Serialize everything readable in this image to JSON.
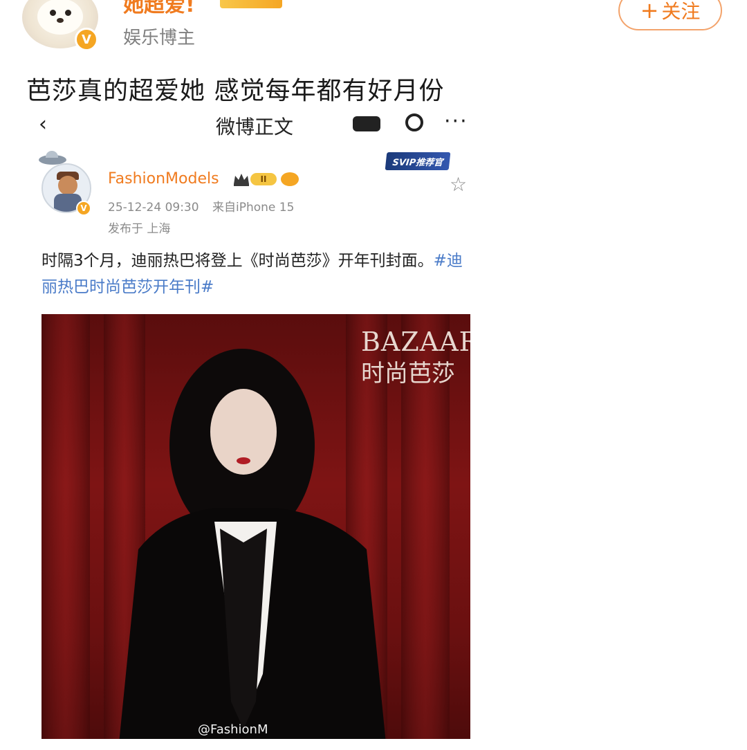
{
  "outer_post": {
    "username": "她超爱!",
    "role": "娱乐博主",
    "follow_label": "关注",
    "follow_plus": "+",
    "verified_mark": "V",
    "text": "芭莎真的超爱她 感觉每年都有好月份"
  },
  "screenshot": {
    "topbar": {
      "back_glyph": "‹",
      "title": "微博正文",
      "more_glyph": "···"
    },
    "post": {
      "username": "FashionModels",
      "level_label": "II",
      "verified_mark": "V",
      "svip_label": "SVIP推荐官",
      "star_glyph": "☆",
      "timestamp": "25-12-24 09:30",
      "source": "来自iPhone 15",
      "location": "发布于 上海",
      "text": "时隔3个月，迪丽热巴将登上《时尚芭莎》开年刊封面。",
      "hashtag": "#迪丽热巴时尚芭莎开年刊#"
    },
    "cover": {
      "masthead": "BAZAAR",
      "masthead_cn": "时尚芭莎",
      "watermark": "@FashionM"
    }
  },
  "colors": {
    "accent_orange": "#f07b1f",
    "hashtag_blue": "#4a7bc8",
    "cover_red": "#7e1414"
  }
}
